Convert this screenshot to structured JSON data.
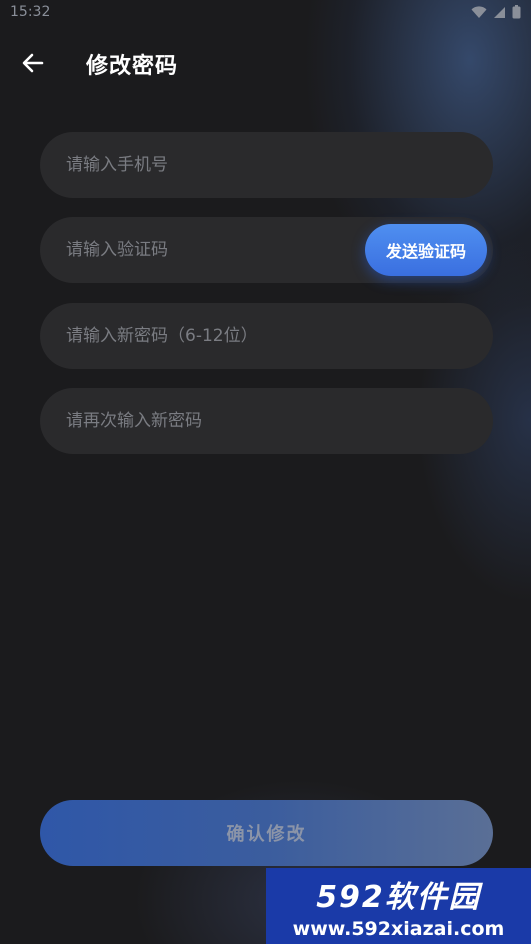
{
  "status_bar": {
    "time": "15:32",
    "icons": [
      "wifi-icon",
      "signal-icon",
      "battery-icon"
    ]
  },
  "header": {
    "back_icon": "arrow-left-icon",
    "title": "修改密码"
  },
  "form": {
    "phone": {
      "placeholder": "请输入手机号",
      "value": ""
    },
    "code": {
      "placeholder": "请输入验证码",
      "value": "",
      "send_button_label": "发送验证码"
    },
    "new_password": {
      "placeholder": "请输入新密码（6-12位）",
      "value": ""
    },
    "confirm_password": {
      "placeholder": "请再次输入新密码",
      "value": ""
    }
  },
  "confirm_button_label": "确认修改",
  "watermark": {
    "logo": "592软件园",
    "url": "www.592xiazai.com"
  },
  "colors": {
    "background": "#1b1b1d",
    "field": "#2a2a2c",
    "accent": "#3a7ae8",
    "watermark_bg": "#1a3aa8"
  }
}
